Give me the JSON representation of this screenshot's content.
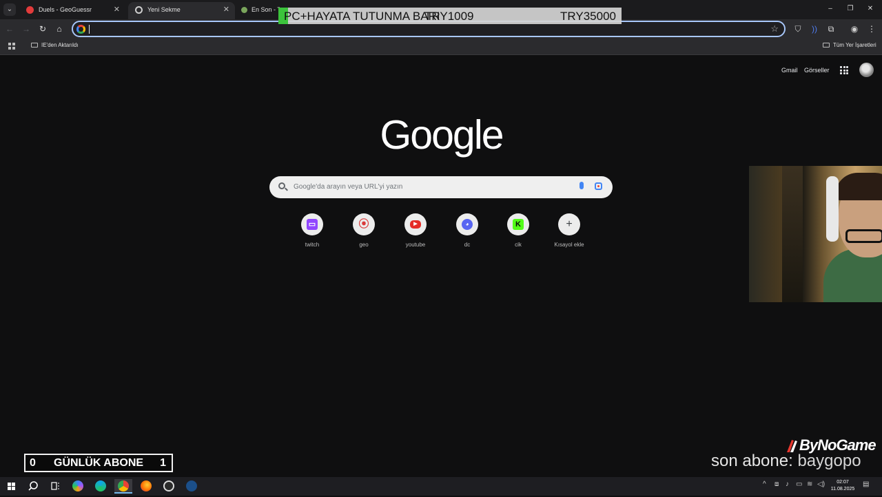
{
  "browser": {
    "tabs": [
      {
        "title": "Duels - GeoGuessr",
        "close": "✕"
      },
      {
        "title": "Yeni Sekme",
        "close": "✕"
      },
      {
        "title": "En Son - T"
      }
    ],
    "address_value": "",
    "bookmarks": {
      "item": "IE'den Aktarıldı",
      "all": "Tüm Yer İşaretleri"
    },
    "window_controls": {
      "minimize": "–",
      "restore": "❐",
      "close": "✕"
    }
  },
  "google": {
    "header_links": {
      "gmail": "Gmail",
      "images": "Görseller"
    },
    "logo": "Google",
    "search_placeholder": "Google'da arayın veya URL'yi yazın",
    "shortcuts": [
      {
        "label": "twitch",
        "icon": "twitch-icon",
        "color": "#9146ff"
      },
      {
        "label": "geo",
        "icon": "map-pin-icon",
        "color": "#d93a3a"
      },
      {
        "label": "youtube",
        "icon": "youtube-icon",
        "color": "#e52d27"
      },
      {
        "label": "dc",
        "icon": "discord-icon",
        "color": "#5865f2"
      },
      {
        "label": "cik",
        "icon": "kick-icon",
        "color": "#53fc18"
      },
      {
        "label": "Kısayol ekle",
        "icon": "plus-icon",
        "color": "#3c4043"
      }
    ]
  },
  "overlay": {
    "donation": {
      "text": "PC+HAYATA TUTUNMA BARI",
      "current": "TRY1009",
      "goal": "TRY35000",
      "progress": 0.029,
      "color": "#3cc43c"
    },
    "daily_subs": {
      "left": "0",
      "label": "GÜNLÜK ABONE",
      "right": "1"
    },
    "brand": "ByNoGame",
    "last_sub": {
      "label": "son abone:",
      "user": "baygopo"
    }
  },
  "taskbar": {
    "time": "02:07",
    "date": "11.08.2025"
  }
}
